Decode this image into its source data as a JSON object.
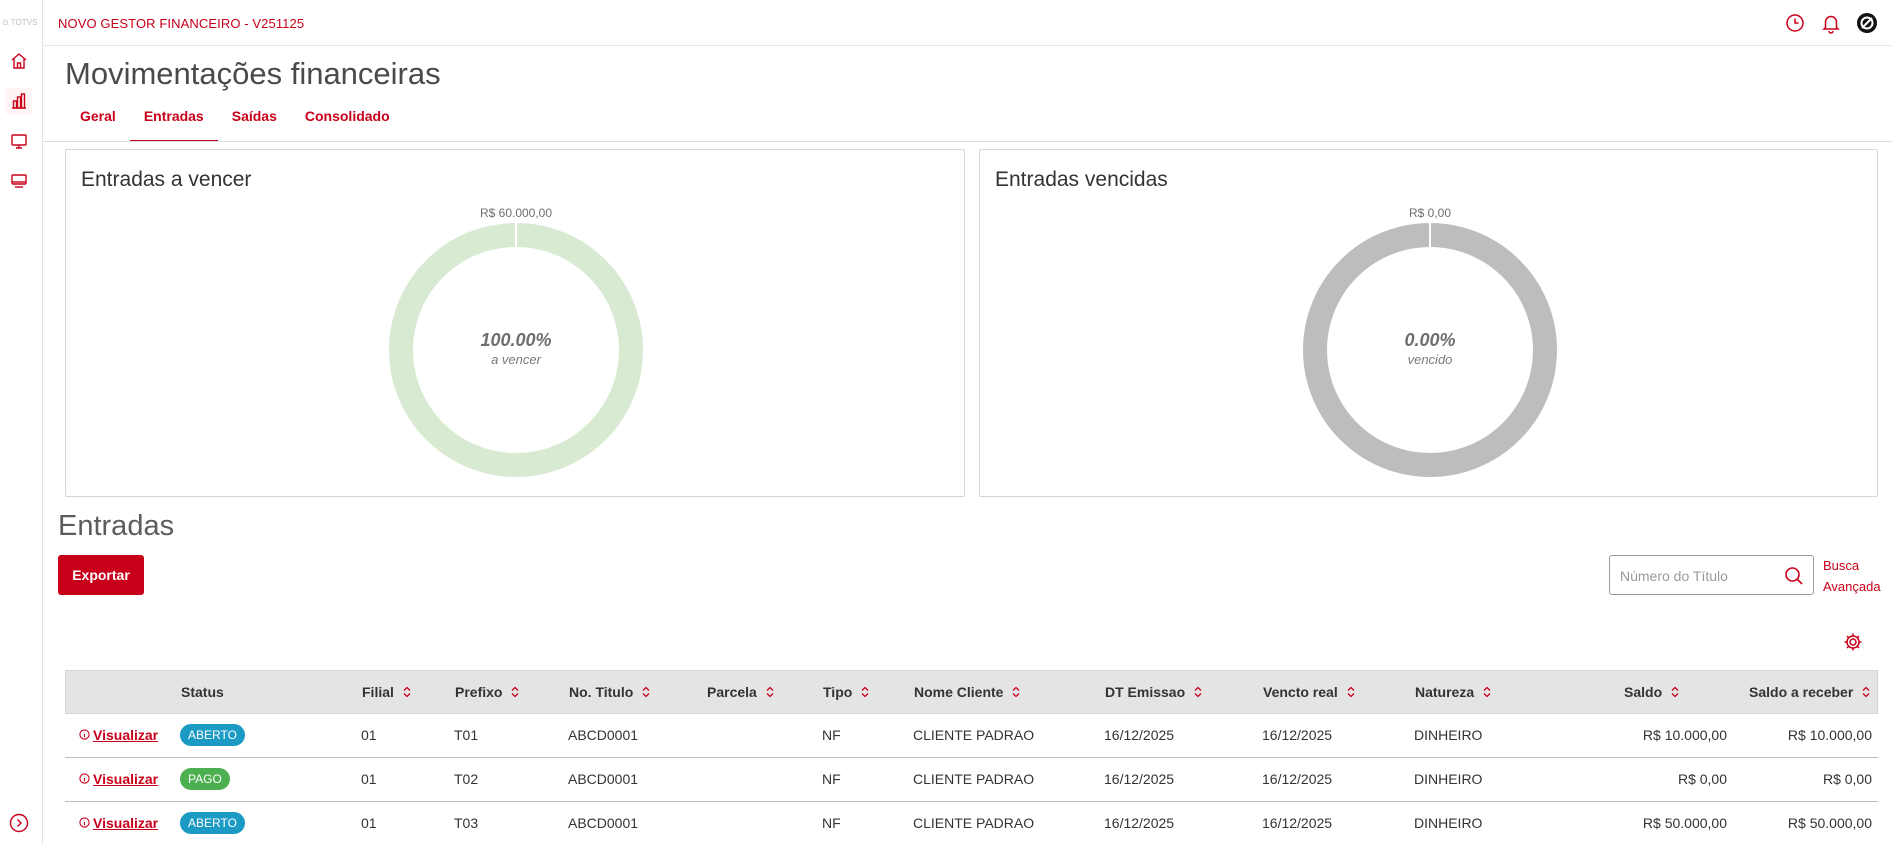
{
  "app": {
    "logo": "TOTVS",
    "title": "NOVO GESTOR FINANCEIRO - V251125",
    "accent": "#c9001a"
  },
  "sidebar": {
    "items": [
      {
        "icon": "home-icon"
      },
      {
        "icon": "bar-chart-icon"
      },
      {
        "icon": "monitor-icon"
      },
      {
        "icon": "desktop-icon"
      }
    ],
    "expand_icon": "chevron-right-circle-icon"
  },
  "topbar": {
    "icons": [
      "clock-icon",
      "bell-icon",
      "user-logo-icon"
    ]
  },
  "page": {
    "title": "Movimentações financeiras",
    "tabs": [
      {
        "label": "Geral",
        "active": false
      },
      {
        "label": "Entradas",
        "active": true
      },
      {
        "label": "Saídas",
        "active": false
      },
      {
        "label": "Consolidado",
        "active": false
      }
    ]
  },
  "cards": [
    {
      "title": "Entradas a vencer",
      "value_label": "R$ 60.000,00",
      "percent": "100.00%",
      "sublabel": "a vencer",
      "fraction": 1.0,
      "color": "#d9ead3"
    },
    {
      "title": "Entradas vencidas",
      "value_label": "R$ 0,00",
      "percent": "0.00%",
      "sublabel": "vencido",
      "fraction": 0.0,
      "color": "#bdbdbd"
    }
  ],
  "entradas": {
    "title": "Entradas",
    "export_label": "Exportar",
    "search_placeholder": "Número do Título",
    "advanced_search_line1": "Busca",
    "advanced_search_line2": "Avançada"
  },
  "table": {
    "columns": [
      "",
      "Status",
      "Filial",
      "Prefixo",
      "No. Titulo",
      "Parcela",
      "Tipo",
      "Nome Cliente",
      "DT Emissao",
      "Vencto real",
      "Natureza",
      "Saldo",
      "Saldo a receber"
    ],
    "rows": [
      {
        "action": "Visualizar",
        "status": "ABERTO",
        "status_color": "#1b9ac4",
        "filial": "01",
        "prefixo": "T01",
        "titulo": "ABCD0001",
        "parcela": "",
        "tipo": "NF",
        "cliente": "CLIENTE PADRAO",
        "emissao": "16/12/2025",
        "vencto": "16/12/2025",
        "natureza": "DINHEIRO",
        "saldo": "R$ 10.000,00",
        "saldo_receber": "R$ 10.000,00"
      },
      {
        "action": "Visualizar",
        "status": "PAGO",
        "status_color": "#4caf50",
        "filial": "01",
        "prefixo": "T02",
        "titulo": "ABCD0001",
        "parcela": "",
        "tipo": "NF",
        "cliente": "CLIENTE PADRAO",
        "emissao": "16/12/2025",
        "vencto": "16/12/2025",
        "natureza": "DINHEIRO",
        "saldo": "R$ 0,00",
        "saldo_receber": "R$ 0,00"
      },
      {
        "action": "Visualizar",
        "status": "ABERTO",
        "status_color": "#1b9ac4",
        "filial": "01",
        "prefixo": "T03",
        "titulo": "ABCD0001",
        "parcela": "",
        "tipo": "NF",
        "cliente": "CLIENTE PADRAO",
        "emissao": "16/12/2025",
        "vencto": "16/12/2025",
        "natureza": "DINHEIRO",
        "saldo": "R$ 50.000,00",
        "saldo_receber": "R$ 50.000,00"
      }
    ]
  }
}
